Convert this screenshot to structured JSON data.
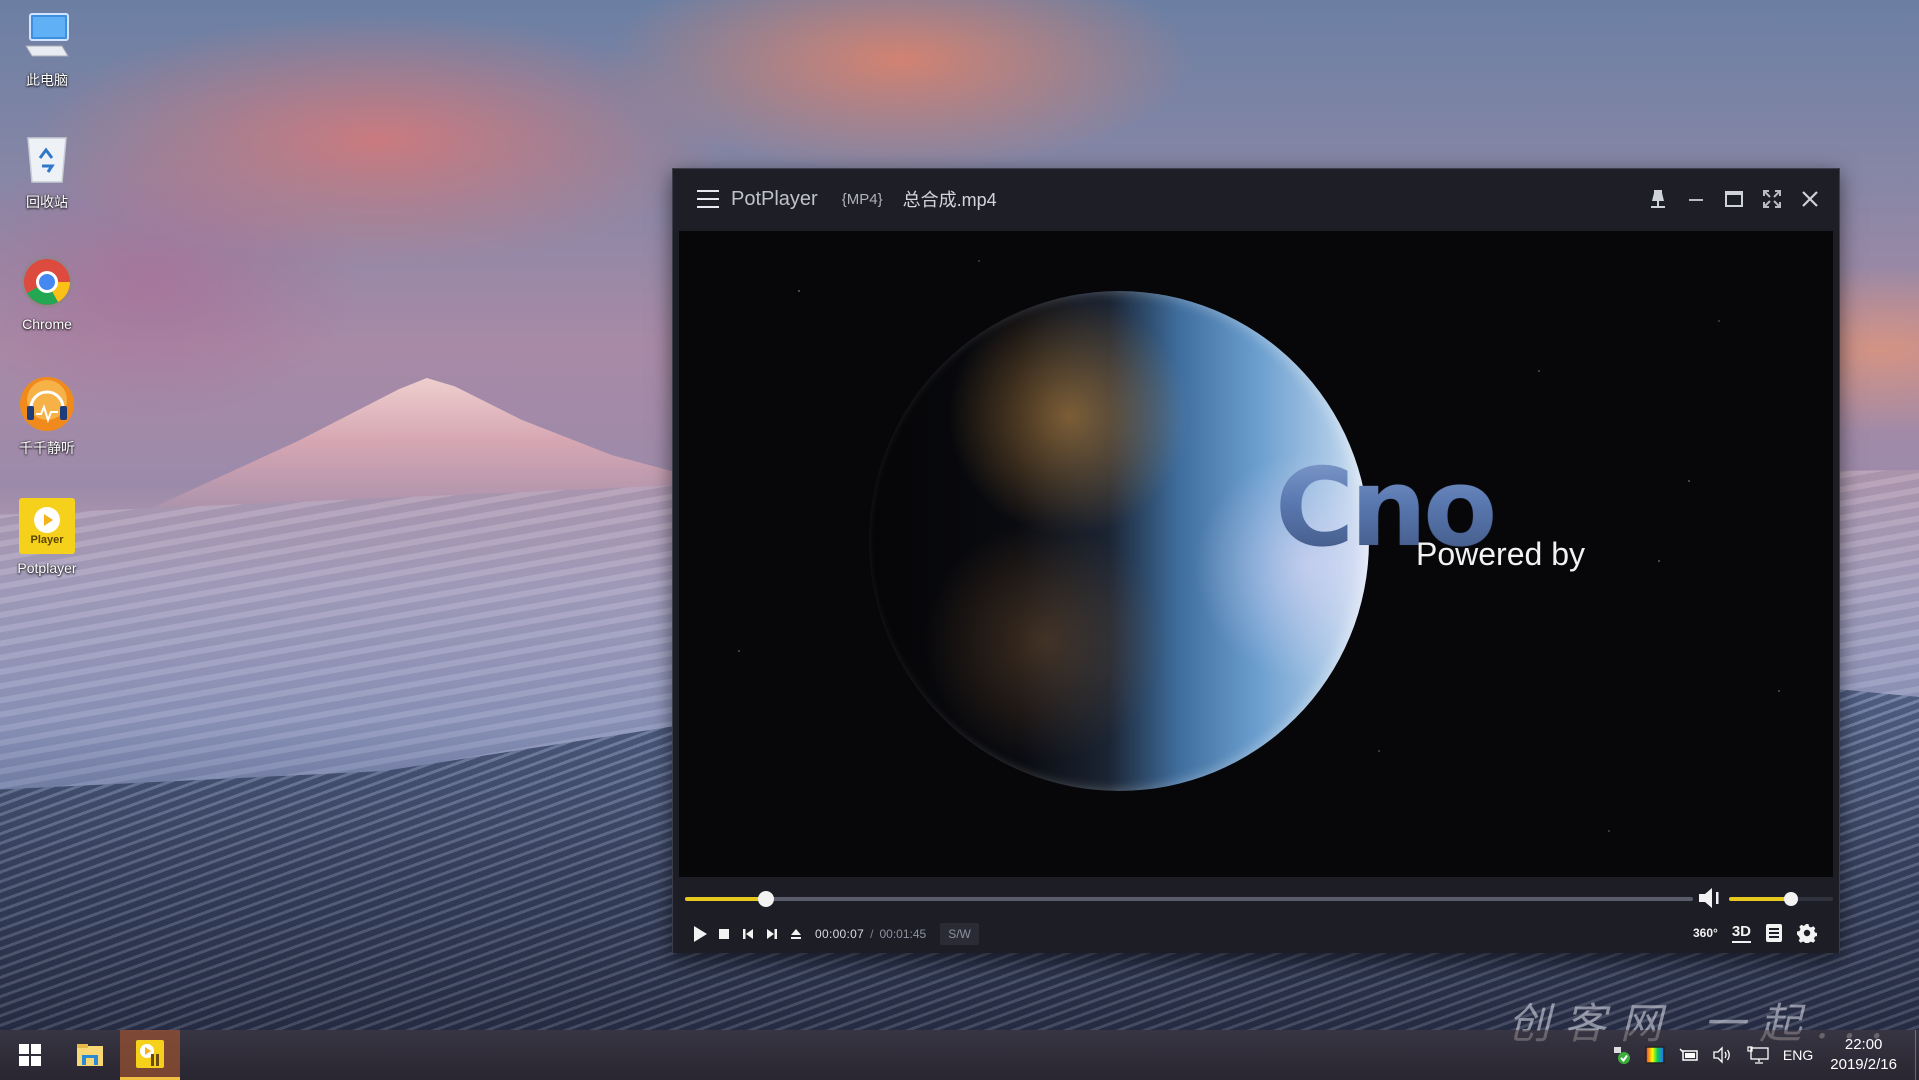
{
  "desktop": {
    "icons": [
      {
        "label": "此电脑",
        "icon": "computer-icon"
      },
      {
        "label": "回收站",
        "icon": "recycle-bin-icon"
      },
      {
        "label": "Chrome",
        "icon": "chrome-icon"
      },
      {
        "label": "千千静听",
        "icon": "ttplayer-icon"
      },
      {
        "label": "Potplayer",
        "icon": "potplayer-icon",
        "icon_text": "Player"
      }
    ],
    "watermark": "创客网 一起..."
  },
  "player": {
    "app_name": "PotPlayer",
    "format": "{MP4}",
    "file_name": "总合成.mp4",
    "window_buttons": [
      "pin",
      "minimize",
      "maximize",
      "fullscreen",
      "close"
    ],
    "video": {
      "title_text": "Cno",
      "subtitle_text": "Powered by"
    },
    "playback": {
      "current_time": "00:00:07",
      "separator": "/",
      "total_time": "00:01:45",
      "progress_fraction": 0.08,
      "volume_fraction": 0.6,
      "decoder_badge": "S/W"
    },
    "right_controls": {
      "vr_label": "360°",
      "three_d_label": "3D",
      "playlist": "playlist-icon",
      "settings": "gear-icon"
    },
    "accent_color": "#e6c81f"
  },
  "taskbar": {
    "apps": [
      "start",
      "file-explorer",
      "potplayer"
    ],
    "tray": {
      "language": "ENG",
      "time": "22:00",
      "date": "2019/2/16"
    }
  }
}
